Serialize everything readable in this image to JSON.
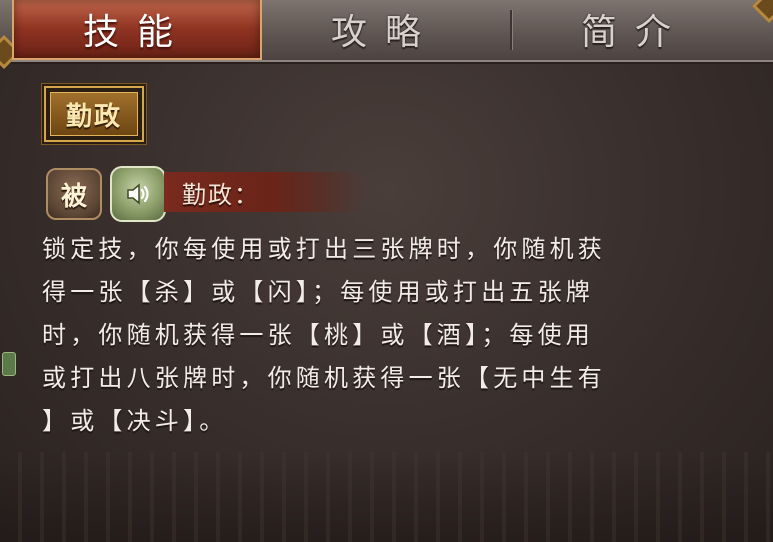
{
  "tabs": {
    "skill": "技能",
    "strategy": "攻略",
    "intro": "简介"
  },
  "skill": {
    "title": "勤政",
    "type_badge": "被",
    "name_label": "勤政：",
    "description_lines": [
      "锁定技，你每使用或打出三张牌时，你随机获",
      "得一张【杀】或【闪】；每使用或打出五张牌",
      "时，你随机获得一张【桃】或【酒】；每使用",
      "或打出八张牌时，你随机获得一张【无中生有",
      "】或【决斗】。"
    ]
  },
  "icons": {
    "voice": "speaker-icon"
  },
  "colors": {
    "active_tab": "#8f3322",
    "title_gold": "#d6a64b",
    "voice_green": "#8c9f6a",
    "name_banner": "#7a2a1e"
  }
}
